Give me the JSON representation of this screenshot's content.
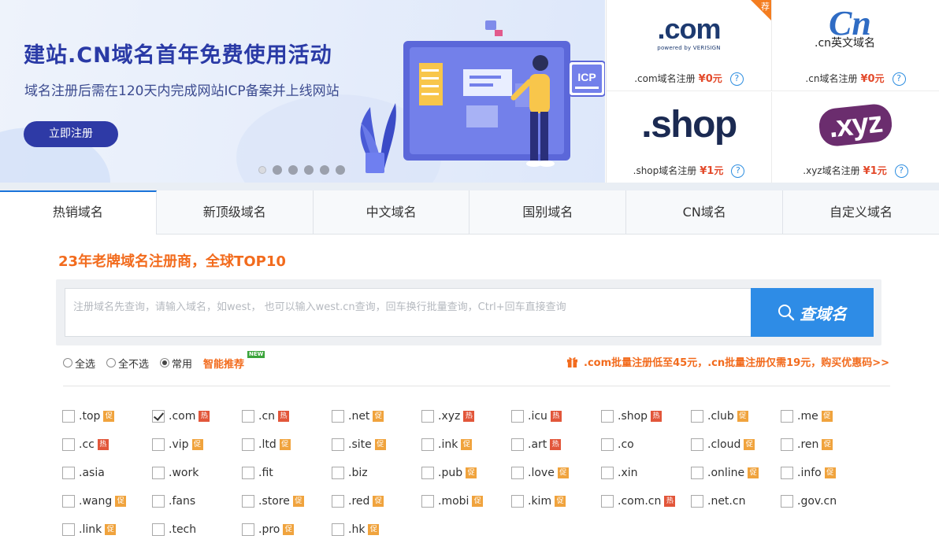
{
  "banner": {
    "title": "建站.CN域名首年免费使用活动",
    "subtitle": "域名注册后需在120天内完成网站ICP备案并上线网站",
    "button_label": "立即注册",
    "illustration_badge": "ICP",
    "slides": 6,
    "active_slide": 1
  },
  "promos": [
    {
      "logo_text": ".com",
      "logo_sub": "powered by VERISIGN",
      "label": ".com域名注册",
      "price": "¥0",
      "unit": "元",
      "corner": "荐"
    },
    {
      "logo_text": "Cn",
      "logo_sub": ".cn英文域名",
      "label": ".cn域名注册",
      "price": "¥0",
      "unit": "元"
    },
    {
      "logo_text": ".shop",
      "label": ".shop域名注册",
      "price": "¥1",
      "unit": "元"
    },
    {
      "logo_text": ".xyz",
      "label": ".xyz域名注册",
      "price": "¥1",
      "unit": "元"
    }
  ],
  "help_icon": "?",
  "tabs": [
    "热销域名",
    "新顶级域名",
    "中文域名",
    "国别域名",
    "CN域名",
    "自定义域名"
  ],
  "active_tab": 0,
  "slogan": "23年老牌域名注册商，全球TOP10",
  "search": {
    "placeholder": "注册域名先查询，请输入域名，如west， 也可以输入west.cn查询，回车换行批量查询，Ctrl+回车直接查询",
    "value": "",
    "button_label": "查域名"
  },
  "select_options": [
    {
      "label": "全选",
      "checked": false
    },
    {
      "label": "全不选",
      "checked": false
    },
    {
      "label": "常用",
      "checked": true
    }
  ],
  "smart_label": "智能推荐",
  "new_badge": "NEW",
  "promo_link": ".com批量注册低至45元，.cn批量注册仅需19元，购买优惠码>>",
  "tag_labels": {
    "cu": "促",
    "re": "热"
  },
  "tlds": [
    [
      {
        "name": ".top",
        "tag": "cu"
      },
      {
        "name": ".com",
        "tag": "re",
        "checked": true
      },
      {
        "name": ".cn",
        "tag": "re"
      },
      {
        "name": ".net",
        "tag": "cu"
      },
      {
        "name": ".xyz",
        "tag": "re"
      },
      {
        "name": ".icu",
        "tag": "re"
      },
      {
        "name": ".shop",
        "tag": "re"
      },
      {
        "name": ".club",
        "tag": "cu"
      },
      {
        "name": ".me",
        "tag": "cu"
      }
    ],
    [
      {
        "name": ".cc",
        "tag": "re"
      },
      {
        "name": ".vip",
        "tag": "cu"
      },
      {
        "name": ".ltd",
        "tag": "cu"
      },
      {
        "name": ".site",
        "tag": "cu"
      },
      {
        "name": ".ink",
        "tag": "cu"
      },
      {
        "name": ".art",
        "tag": "re"
      },
      {
        "name": ".co",
        "tag": ""
      },
      {
        "name": ".cloud",
        "tag": "cu"
      },
      {
        "name": ".ren",
        "tag": "cu"
      }
    ],
    [
      {
        "name": ".asia",
        "tag": ""
      },
      {
        "name": ".work",
        "tag": ""
      },
      {
        "name": ".fit",
        "tag": ""
      },
      {
        "name": ".biz",
        "tag": ""
      },
      {
        "name": ".pub",
        "tag": "cu"
      },
      {
        "name": ".love",
        "tag": "cu"
      },
      {
        "name": ".xin",
        "tag": ""
      },
      {
        "name": ".online",
        "tag": "cu"
      },
      {
        "name": ".info",
        "tag": "cu"
      }
    ],
    [
      {
        "name": ".wang",
        "tag": "cu"
      },
      {
        "name": ".fans",
        "tag": ""
      },
      {
        "name": ".store",
        "tag": "cu"
      },
      {
        "name": ".red",
        "tag": "cu"
      },
      {
        "name": ".mobi",
        "tag": "cu"
      },
      {
        "name": ".kim",
        "tag": "cu"
      },
      {
        "name": ".com.cn",
        "tag": "re"
      },
      {
        "name": ".net.cn",
        "tag": ""
      },
      {
        "name": ".gov.cn",
        "tag": ""
      }
    ],
    [
      {
        "name": ".link",
        "tag": "cu"
      },
      {
        "name": ".tech",
        "tag": ""
      },
      {
        "name": ".pro",
        "tag": "cu"
      },
      {
        "name": ".hk",
        "tag": "cu"
      }
    ]
  ],
  "colors": {
    "accent": "#2e8ce6",
    "orange": "#f26b1d",
    "tag_cu": "#f0a33d",
    "tag_re": "#e2563a",
    "banner_navy": "#2e3aa6"
  }
}
